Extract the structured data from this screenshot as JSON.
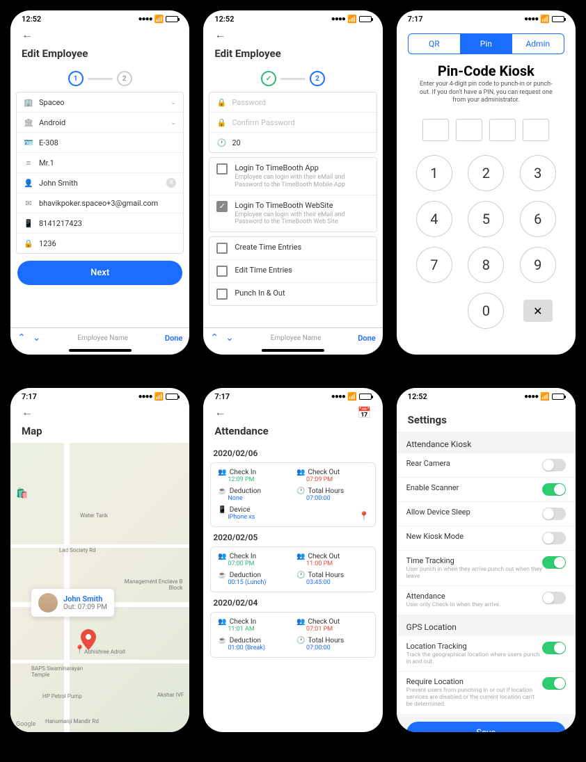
{
  "status": {
    "time1252": "12:52",
    "time717": "7:17"
  },
  "s1": {
    "title": "Edit Employee",
    "step1": "1",
    "step2": "2",
    "fields": {
      "company": "Spaceo",
      "platform": "Android",
      "employee_id": "E-308",
      "prefix": "Mr.1",
      "name": "John Smith",
      "email": "bhavikpoker.spaceo+3@gmail.com",
      "phone": "8141217423",
      "pin": "1236"
    },
    "next": "Next",
    "kbd_hint": "Employee Name",
    "done": "Done"
  },
  "s2": {
    "title": "Edit Employee",
    "step2": "2",
    "password_ph": "Password",
    "confirm_ph": "Confirm Password",
    "hours": "20",
    "perms": {
      "login_app": "Login To TimeBooth App",
      "login_app_desc": "Employee can login with their eMail and Password to the TimeBooth Mobile App",
      "login_web": "Login To TimeBooth WebSite",
      "login_web_desc": "Employee can login with their eMail and Password to the TimeBooth Web Site",
      "create_entries": "Create Time Entries",
      "edit_entries": "Edit Time Entries",
      "punch": "Punch In & Out"
    },
    "kbd_hint": "Employee Name",
    "done": "Done"
  },
  "s3": {
    "tab_qr": "QR",
    "tab_pin": "Pin",
    "tab_admin": "Admin",
    "title": "Pin-Code Kiosk",
    "subtitle": "Enter your 4-digit pin code to punch-in or punch-out. If you don't have a PIN, you can request one from  your administrator.",
    "k1": "1",
    "k2": "2",
    "k3": "3",
    "k4": "4",
    "k5": "5",
    "k6": "6",
    "k7": "7",
    "k8": "8",
    "k9": "9",
    "k0": "0"
  },
  "s4": {
    "title": "Map",
    "bubble_name": "John Smith",
    "bubble_time": "Out: 07:09 PM",
    "labels": {
      "water": "Water Tank",
      "society": "Lad Society Rd",
      "mgmt": "Management Enclave B Block",
      "abhi": "Abhishree Adroit",
      "temple": "BAPS Swaminarayan Temple",
      "hp": "HP Petrol Pump",
      "ivf": "Akshar IVF",
      "hanu": "Hanumanji Mandir Rd"
    },
    "google": "Google"
  },
  "s5": {
    "title": "Attendance",
    "dates": {
      "d1": "2020/02/06",
      "d2": "2020/02/05",
      "d3": "2020/02/04"
    },
    "labels": {
      "checkin": "Check In",
      "checkout": "Check Out",
      "deduction": "Deduction",
      "total": "Total Hours",
      "device": "Device"
    },
    "c1": {
      "in": "12:09 PM",
      "out": "07:09 PM",
      "ded": "None",
      "total": "07:00:00",
      "device": "iPhone xs"
    },
    "c2": {
      "in": "07:00 PM",
      "out": "11:00 PM",
      "ded": "00:15 (Lunch)",
      "total": "03:45:00"
    },
    "c3": {
      "in": "11:01 AM",
      "out": "07:01 PM",
      "ded": "01:00 (Break)",
      "total": "07:00:00"
    }
  },
  "s6": {
    "title": "Settings",
    "section1": "Attendance Kiosk",
    "rows": {
      "rear": "Rear Camera",
      "scanner": "Enable Scanner",
      "sleep": "Allow Device Sleep",
      "kiosk": "New Kiosk Mode",
      "tracking": "Time Tracking",
      "tracking_desc": "User punch in when they arrive punch out when they leave",
      "attendance": "Attendance",
      "attendance_desc": "User only Check-In when they arrive."
    },
    "section2": "GPS Location",
    "rows2": {
      "loc": "Location Tracking",
      "loc_desc": "Track the geographical location where users punch in and out.",
      "req": "Require Location",
      "req_desc": "Prevent users from punching in or out if location services are disabled or the current location can't be determined."
    },
    "save": "Save"
  }
}
